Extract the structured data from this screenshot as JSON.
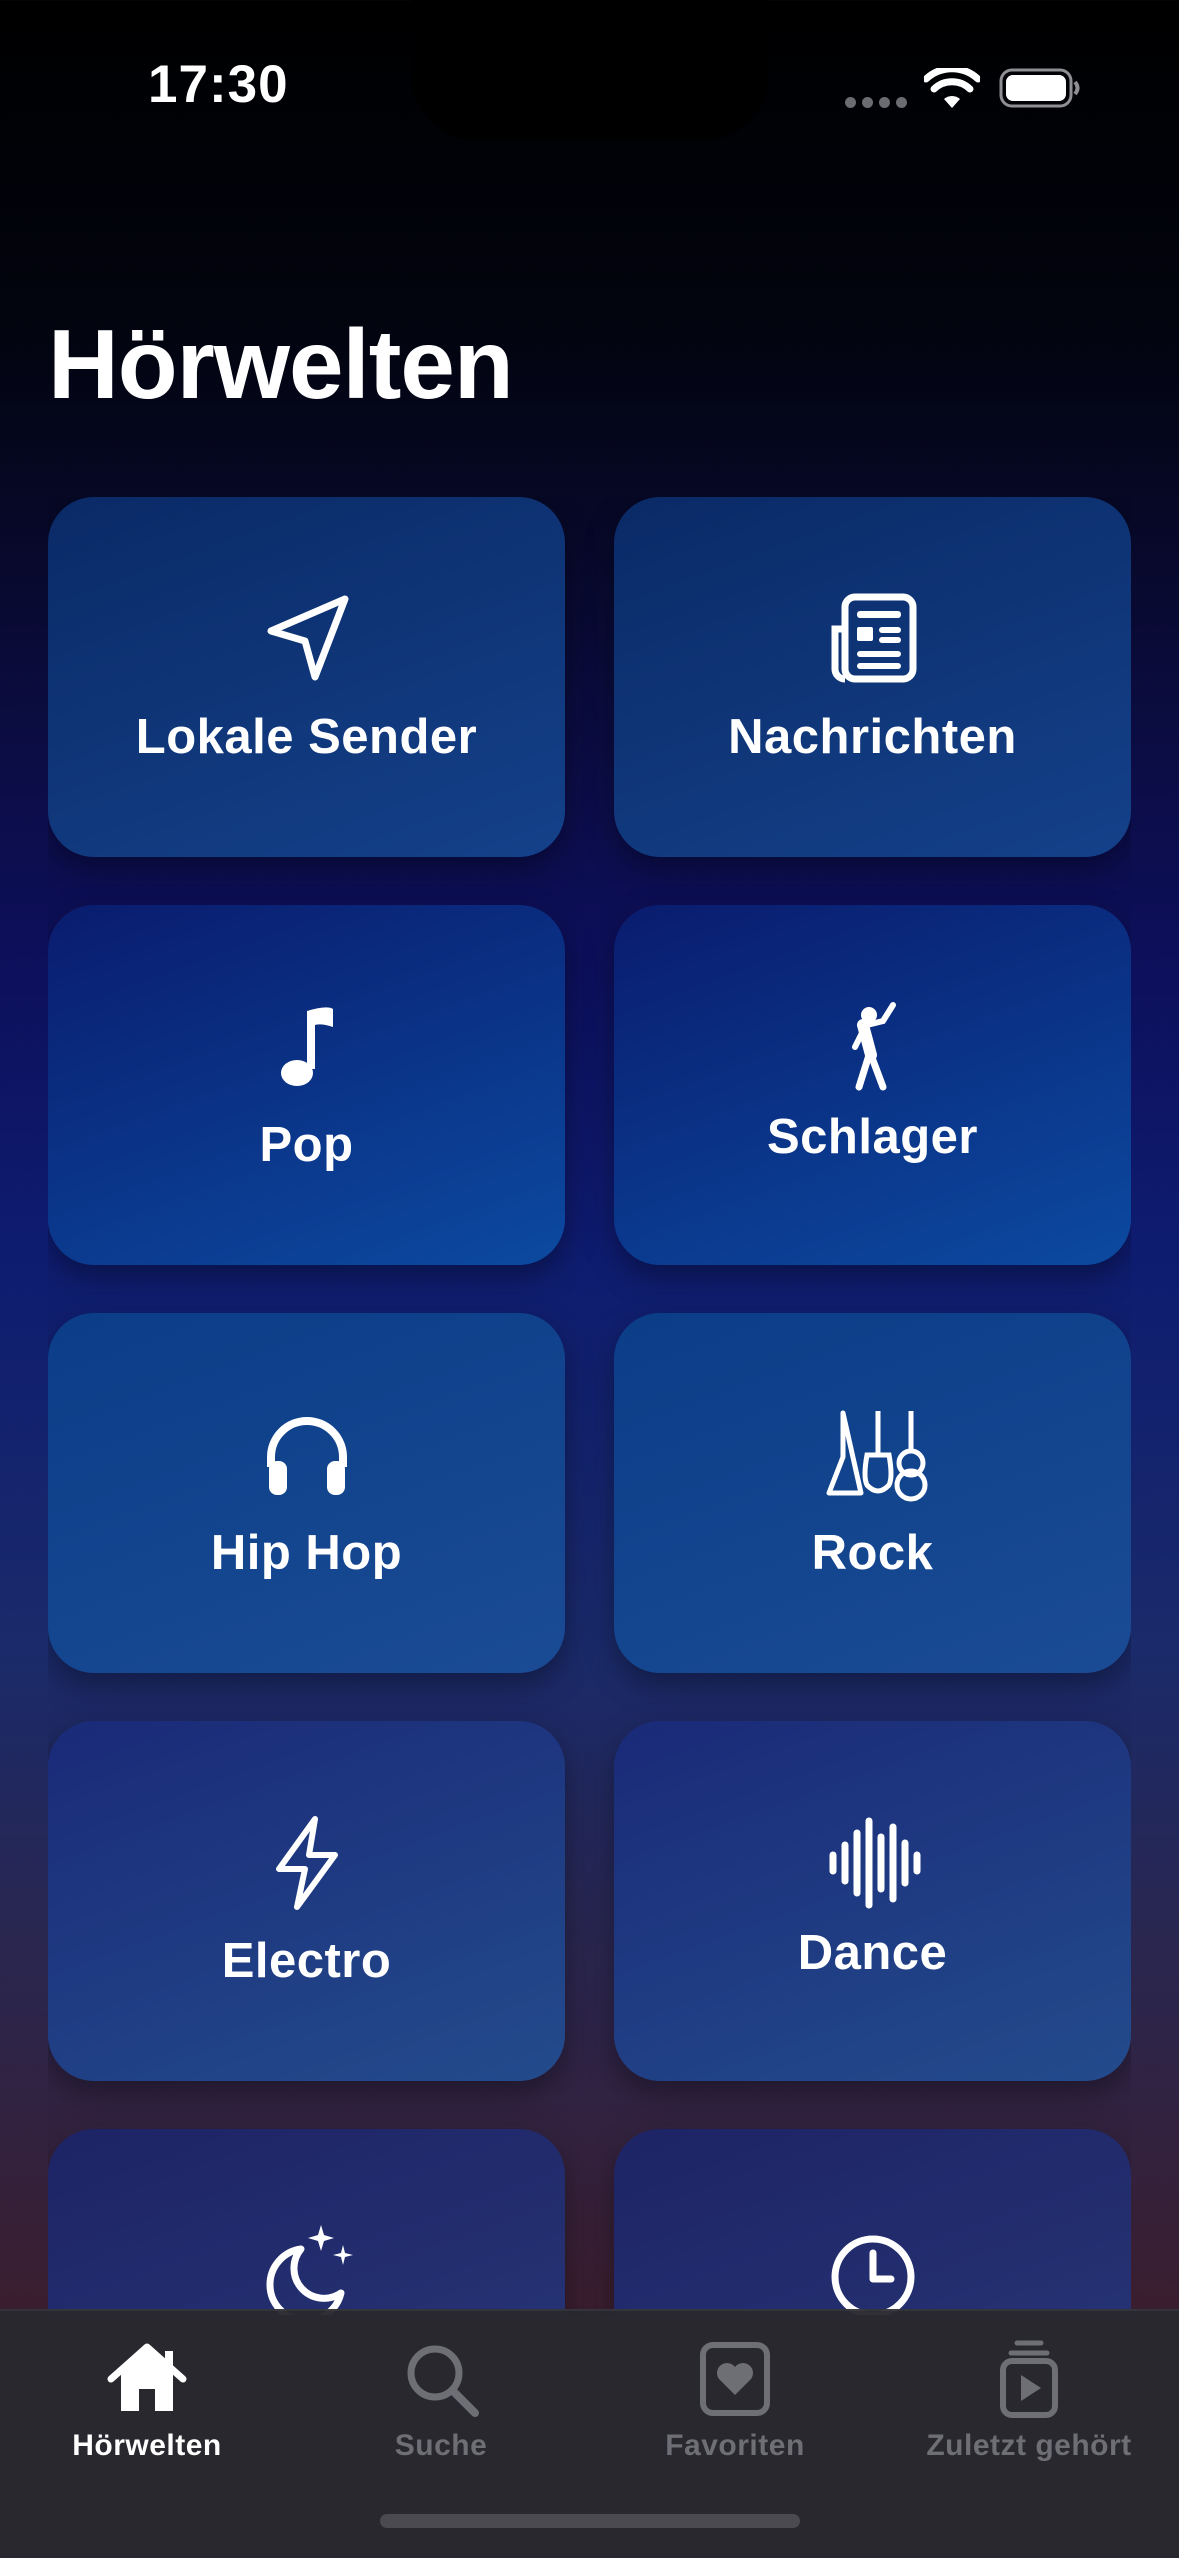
{
  "status_bar": {
    "time": "17:30"
  },
  "page": {
    "title": "Hörwelten"
  },
  "categories": [
    {
      "label": "Lokale Sender",
      "icon": "location-arrow-icon"
    },
    {
      "label": "Nachrichten",
      "icon": "newspaper-icon"
    },
    {
      "label": "Pop",
      "icon": "music-note-icon"
    },
    {
      "label": "Schlager",
      "icon": "dancer-icon"
    },
    {
      "label": "Hip Hop",
      "icon": "headphones-icon"
    },
    {
      "label": "Rock",
      "icon": "guitars-icon"
    },
    {
      "label": "Electro",
      "icon": "lightning-bolt-icon"
    },
    {
      "label": "Dance",
      "icon": "waveform-icon"
    },
    {
      "label": "",
      "icon": "moon-stars-icon"
    },
    {
      "label": "",
      "icon": "clock-icon"
    }
  ],
  "tab_bar": {
    "tabs": [
      {
        "label": "Hörwelten",
        "icon": "house-icon",
        "active": true
      },
      {
        "label": "Suche",
        "icon": "magnifier-icon",
        "active": false
      },
      {
        "label": "Favoriten",
        "icon": "heart-square-icon",
        "active": false
      },
      {
        "label": "Zuletzt gehört",
        "icon": "play-stack-icon",
        "active": false
      }
    ]
  },
  "colors": {
    "text": "#ffffff",
    "tab_inactive": "#6e6e75",
    "tab_bar_bg": "#28282e",
    "tile_blue": "#0b4aa0"
  }
}
